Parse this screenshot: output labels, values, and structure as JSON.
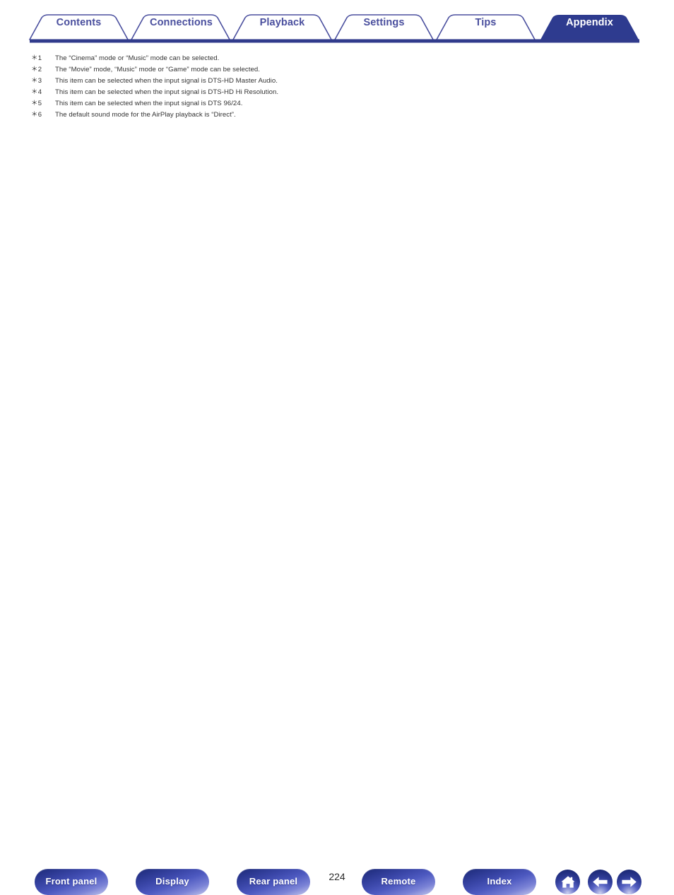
{
  "tabs": [
    {
      "label": "Contents",
      "active": false,
      "name": "tab-contents"
    },
    {
      "label": "Connections",
      "active": false,
      "name": "tab-connections"
    },
    {
      "label": "Playback",
      "active": false,
      "name": "tab-playback"
    },
    {
      "label": "Settings",
      "active": false,
      "name": "tab-settings"
    },
    {
      "label": "Tips",
      "active": false,
      "name": "tab-tips"
    },
    {
      "label": "Appendix",
      "active": true,
      "name": "tab-appendix"
    }
  ],
  "footnotes": [
    {
      "mark": "＊1",
      "text": "The “Cinema” mode or “Music” mode can be selected."
    },
    {
      "mark": "＊2",
      "text": "The “Movie” mode, “Music” mode or “Game” mode can be selected."
    },
    {
      "mark": "＊3",
      "text": "This item can be selected when the input signal is DTS-HD Master Audio."
    },
    {
      "mark": "＊4",
      "text": "This item can be selected when the input signal is DTS-HD Hi Resolution."
    },
    {
      "mark": "＊5",
      "text": "This item can be selected when the input signal is DTS 96/24."
    },
    {
      "mark": "＊6",
      "text": "The default sound mode for the AirPlay playback is “Direct”."
    }
  ],
  "footer": {
    "buttons": [
      {
        "label": "Front panel",
        "name": "front-panel-button"
      },
      {
        "label": "Display",
        "name": "display-button"
      },
      {
        "label": "Rear panel",
        "name": "rear-panel-button"
      },
      {
        "label": "Remote",
        "name": "remote-button"
      },
      {
        "label": "Index",
        "name": "index-button"
      }
    ],
    "page_number": "224",
    "nav_icons": [
      {
        "icon": "home-icon",
        "name": "home-button"
      },
      {
        "icon": "arrow-left-icon",
        "name": "previous-page-button"
      },
      {
        "icon": "arrow-right-icon",
        "name": "next-page-button"
      }
    ]
  },
  "colors": {
    "tab_outline": "#4a4f9e",
    "tab_text": "#4a4f9e",
    "tab_active_fill": "#2e3b8f",
    "tab_active_text": "#ffffff",
    "bottom_border": "#313b8c",
    "footnote_text": "#333333",
    "page_number_text": "#2b2b2b",
    "button_dark": "#1d2a75",
    "button_light": "#d6d9f2",
    "page_background": "#ffffff"
  }
}
